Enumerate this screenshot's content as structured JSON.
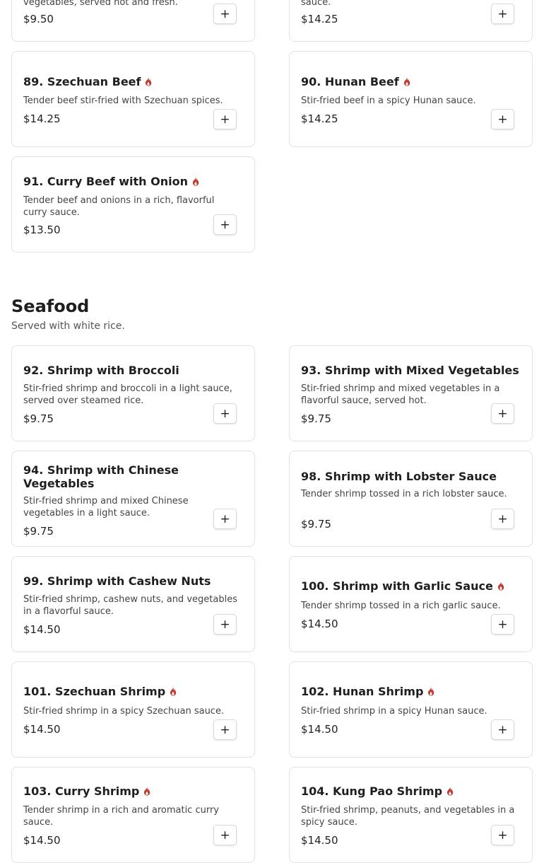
{
  "icons": {
    "spicy": "flame-icon",
    "add": "plus-icon"
  },
  "colors": {
    "spicy": "#c0392b",
    "card_border": "#e2e2e2"
  },
  "beef_partial": [
    {
      "desc": "vegetables, served hot and fresh.",
      "price": "$9.50",
      "add_label": "+"
    },
    {
      "desc": "sauce.",
      "price": "$14.25",
      "add_label": "+"
    }
  ],
  "beef": [
    {
      "name": "89. Szechuan Beef",
      "spicy": true,
      "desc": "Tender beef stir-fried with Szechuan spices.",
      "price": "$14.25",
      "add_label": "+"
    },
    {
      "name": "90. Hunan Beef",
      "spicy": true,
      "desc": "Stir-fried beef in a spicy Hunan sauce.",
      "price": "$14.25",
      "add_label": "+"
    },
    {
      "name": "91. Curry Beef with Onion",
      "spicy": true,
      "desc": "Tender beef and onions in a rich, flavorful curry sauce.",
      "price": "$13.50",
      "add_label": "+"
    }
  ],
  "seafood": {
    "title": "Seafood",
    "subtitle": "Served with white rice.",
    "items": [
      {
        "name": "92. Shrimp with Broccoli",
        "spicy": false,
        "desc": "Stir-fried shrimp and broccoli in a light sauce, served over steamed rice.",
        "price": "$9.75",
        "add_label": "+"
      },
      {
        "name": "93. Shrimp with Mixed Vegetables",
        "spicy": false,
        "desc": "Stir-fried shrimp and mixed vegetables in a flavorful sauce, served hot.",
        "price": "$9.75",
        "add_label": "+"
      },
      {
        "name": "94. Shrimp with Chinese Vegetables",
        "spicy": false,
        "desc": "Stir-fried shrimp and mixed Chinese vegetables in a light sauce.",
        "price": "$9.75",
        "add_label": "+"
      },
      {
        "name": "98. Shrimp with Lobster Sauce",
        "spicy": false,
        "desc": "Tender shrimp tossed in a rich lobster sauce.",
        "price": "$9.75",
        "add_label": "+"
      },
      {
        "name": "99. Shrimp with Cashew Nuts",
        "spicy": false,
        "desc": "Stir-fried shrimp, cashew nuts, and vegetables in a flavorful sauce.",
        "price": "$14.50",
        "add_label": "+"
      },
      {
        "name": "100. Shrimp with Garlic Sauce",
        "spicy": true,
        "desc": "Tender shrimp tossed in a rich garlic sauce.",
        "price": "$14.50",
        "add_label": "+"
      },
      {
        "name": "101. Szechuan Shrimp",
        "spicy": true,
        "desc": "Stir-fried shrimp in a spicy Szechuan sauce.",
        "price": "$14.50",
        "add_label": "+"
      },
      {
        "name": "102. Hunan Shrimp",
        "spicy": true,
        "desc": "Stir-fried shrimp in a spicy Hunan sauce.",
        "price": "$14.50",
        "add_label": "+"
      },
      {
        "name": "103. Curry Shrimp",
        "spicy": true,
        "desc": "Tender shrimp in a rich and aromatic curry sauce.",
        "price": "$14.50",
        "add_label": "+"
      },
      {
        "name": "104. Kung Pao Shrimp",
        "spicy": true,
        "desc": "Stir-fried shrimp, peanuts, and vegetables in a spicy sauce.",
        "price": "$14.50",
        "add_label": "+"
      }
    ]
  }
}
